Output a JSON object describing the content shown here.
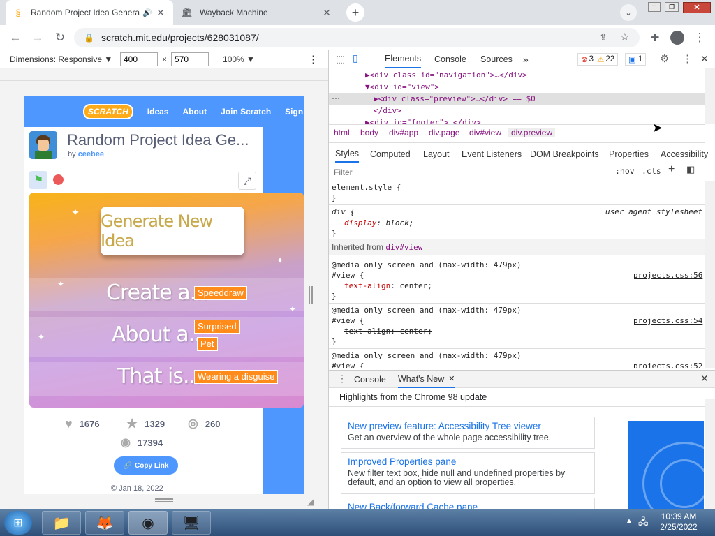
{
  "browser": {
    "tabs": [
      {
        "title": "Random Project Idea Genera",
        "active": true
      },
      {
        "title": "Wayback Machine",
        "active": false
      }
    ],
    "url": "scratch.mit.edu/projects/628031087/"
  },
  "device_toolbar": {
    "dimensions_label": "Dimensions: Responsive ▼",
    "width": "400",
    "times": "×",
    "height": "570",
    "zoom": "100% ▼"
  },
  "scratch": {
    "logo": "SCRATCH",
    "nav": [
      "Ideas",
      "About",
      "Join Scratch",
      "Sign"
    ],
    "project_title": "Random Project Idea Ge...",
    "by": "by",
    "author": "ceebee",
    "generate_button": "Generate New Idea",
    "rows": [
      {
        "label": "Create a...",
        "chips": [
          "Speeddraw"
        ]
      },
      {
        "label": "About a...",
        "chips": [
          "Surprised",
          "Pet"
        ]
      },
      {
        "label": "That is...",
        "chips": [
          "Wearing a disguise"
        ]
      }
    ],
    "stats": {
      "loves": "1676",
      "favorites": "1329",
      "remixes": "260",
      "views": "17394"
    },
    "copy_link": "Copy Link",
    "date": "© Jan 18, 2022"
  },
  "devtools": {
    "tabs": [
      "Elements",
      "Console",
      "Sources"
    ],
    "errors": "3",
    "warnings": "22",
    "messages": "1",
    "dom_lines": [
      "▶<div class id=\"navigation\">…</div>",
      "▼<div id=\"view\">",
      "▶<div class=\"preview\">…</div> == $0",
      "</div>",
      "▶<div id=\"footer\">…</div>"
    ],
    "breadcrumbs": [
      "html",
      "body",
      "div#app",
      "div.page",
      "div#view",
      "div.preview"
    ],
    "subtabs": [
      "Styles",
      "Computed",
      "Layout",
      "Event Listeners",
      "DOM Breakpoints",
      "Properties",
      "Accessibility"
    ],
    "filter_placeholder": "Filter",
    "hov": ":hov",
    "cls": ".cls",
    "styles": {
      "element_style": "element.style {",
      "close": "}",
      "div_rule": "div {",
      "ua": "user agent stylesheet",
      "display_prop": "display",
      "display_val": "block;",
      "inherited_label": "Inherited from",
      "inherited_el": "div#view",
      "media": "@media only screen and (max-width: 479px)",
      "view_sel": "#view {",
      "ta_prop": "text-align",
      "ta_val": "center;",
      "ta_struck": "text-align: center;",
      "links": [
        "projects.css:56",
        "projects.css:54",
        "projects.css:52"
      ]
    },
    "drawer": {
      "tabs": [
        "Console",
        "What's New"
      ],
      "highlights": "Highlights from the Chrome 98 update",
      "cards": [
        {
          "title": "New preview feature: Accessibility Tree viewer",
          "desc": "Get an overview of the whole page accessibility tree."
        },
        {
          "title": "Improved Properties pane",
          "desc": "New filter text box, hide null and undefined properties by default, and an option to view all properties."
        },
        {
          "title": "New Back/forward Cache pane",
          "desc": ""
        }
      ]
    }
  },
  "taskbar": {
    "time": "10:39 AM",
    "date": "2/25/2022",
    "apps": [
      "folder-icon",
      "firefox-icon",
      "chrome-icon",
      "control-panel-icon"
    ]
  }
}
